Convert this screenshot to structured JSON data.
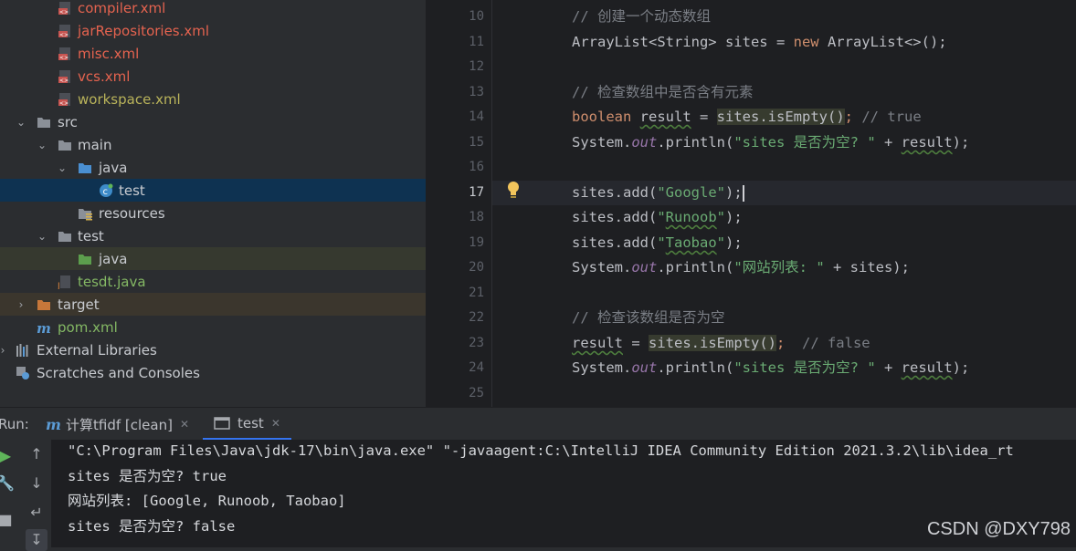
{
  "project_tree": [
    {
      "label": "compiler.xml",
      "color": "red",
      "indent": 85,
      "icon": "xml-file-icon"
    },
    {
      "label": "jarRepositories.xml",
      "color": "red",
      "indent": 85,
      "icon": "xml-file-icon"
    },
    {
      "label": "misc.xml",
      "color": "red",
      "indent": 85,
      "icon": "xml-file-icon"
    },
    {
      "label": "vcs.xml",
      "color": "red",
      "indent": 85,
      "icon": "xml-file-icon"
    },
    {
      "label": "workspace.xml",
      "color": "yellow",
      "indent": 85,
      "icon": "xml-file-icon"
    },
    {
      "label": "src",
      "color": "normal",
      "indent": 63,
      "icon": "folder-icon",
      "arrow": "down"
    },
    {
      "label": "main",
      "color": "normal",
      "indent": 85,
      "icon": "folder-icon",
      "arrow": "down"
    },
    {
      "label": "java",
      "color": "normal",
      "indent": 108,
      "icon": "source-folder-icon",
      "arrow": "down"
    },
    {
      "label": "test",
      "color": "normal",
      "indent": 130,
      "icon": "java-class-icon",
      "selected": true
    },
    {
      "label": "resources",
      "color": "normal",
      "indent": 108,
      "icon": "resources-folder-icon"
    },
    {
      "label": "test",
      "color": "normal",
      "indent": 85,
      "icon": "folder-icon",
      "arrow": "down"
    },
    {
      "label": "java",
      "color": "normal",
      "indent": 108,
      "icon": "test-source-folder-icon"
    },
    {
      "label": "tesdt.java",
      "color": "green",
      "indent": 85,
      "icon": "java-file-icon"
    },
    {
      "label": "target",
      "color": "normal",
      "indent": 63,
      "icon": "excluded-folder-icon",
      "arrow": "right"
    },
    {
      "label": "pom.xml",
      "color": "green",
      "indent": 63,
      "icon": "maven-icon"
    },
    {
      "label": "External Libraries",
      "color": "normal",
      "indent": 40,
      "icon": "libraries-icon",
      "arrow": "right"
    },
    {
      "label": "Scratches and Consoles",
      "color": "normal",
      "indent": 40,
      "icon": "scratches-icon"
    }
  ],
  "editor": {
    "line_numbers": [
      "10",
      "11",
      "12",
      "13",
      "14",
      "15",
      "16",
      "17",
      "18",
      "19",
      "20",
      "21",
      "22",
      "23",
      "24",
      "25"
    ],
    "current_line": "17",
    "lines": {
      "l10": "// 创建一个动态数组",
      "l11_a": "ArrayList<String> sites = ",
      "l11_kw": "new",
      "l11_b": " ArrayList<>();",
      "l13": "// 检查数组中是否含有元素",
      "l14_kw": "boolean",
      "l14_var": "result",
      "l14_eq": " = ",
      "l14_call": "sites.isEmpty()",
      "l14_semi": "; ",
      "l14_cm": "// true",
      "l15_a": "System.",
      "l15_out": "out",
      "l15_b": ".println(",
      "l15_str": "\"sites 是否为空? \"",
      "l15_c": " + ",
      "l15_var": "result",
      "l15_d": ");",
      "l17_a": "sites.add(",
      "l17_str": "\"Google\"",
      "l17_b": ");",
      "l18_a": "sites.add(",
      "l18_str_q1": "\"",
      "l18_str": "Runoob",
      "l18_str_q2": "\"",
      "l18_b": ");",
      "l19_a": "sites.add(",
      "l19_str_q1": "\"",
      "l19_str": "Taobao",
      "l19_str_q2": "\"",
      "l19_b": ");",
      "l20_a": "System.",
      "l20_out": "out",
      "l20_b": ".println(",
      "l20_str": "\"网站列表: \"",
      "l20_c": " + sites);",
      "l22": "// 检查该数组是否为空",
      "l23_var": "result",
      "l23_eq": " = ",
      "l23_call": "sites.isEmpty()",
      "l23_semi": ";  ",
      "l23_cm": "// false",
      "l24_a": "System.",
      "l24_out": "out",
      "l24_b": ".println(",
      "l24_str": "\"sites 是否为空? \"",
      "l24_c": " + ",
      "l24_var": "result",
      "l24_d": ");"
    }
  },
  "run": {
    "label": "Run:",
    "tabs": [
      {
        "label": "计算tfidf [clean]",
        "icon": "maven-icon"
      },
      {
        "label": "test",
        "icon": "console-icon",
        "active": true
      }
    ],
    "output": [
      "\"C:\\Program Files\\Java\\jdk-17\\bin\\java.exe\" \"-javaagent:C:\\IntelliJ IDEA Community Edition 2021.3.2\\lib\\idea_rt",
      "sites 是否为空? true",
      "网站列表: [Google, Runoob, Taobao]",
      "sites 是否为空? false"
    ]
  },
  "watermark": "CSDN @DXY798",
  "colors": {
    "accent": "#3574f0",
    "keyword": "#cf8e6d",
    "string": "#6aab73",
    "comment": "#7a7e85",
    "error_file": "#e5634f"
  }
}
